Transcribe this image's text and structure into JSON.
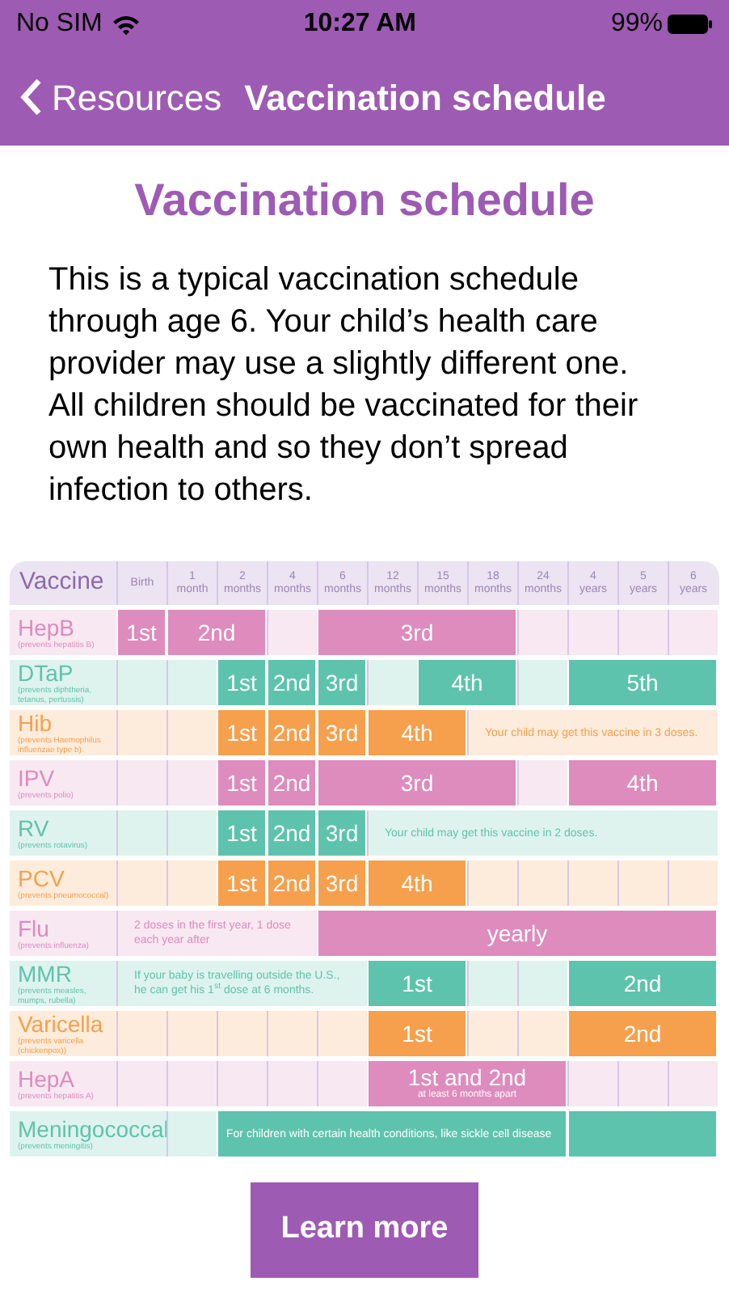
{
  "status_bar": {
    "carrier": "No SIM",
    "time": "10:27 AM",
    "battery": "99%"
  },
  "nav": {
    "back": "Resources",
    "title": "Vaccination schedule"
  },
  "heading": "Vaccination schedule",
  "intro": "This is a typical vaccination schedule through age 6. Your child’s health care provider may use a slightly different one. All children should be vaccinated for their own health and so they don’t spread infection to others.",
  "table": {
    "header": "Vaccine",
    "columns": [
      {
        "lines": [
          "Birth"
        ]
      },
      {
        "lines": [
          "1",
          "month"
        ]
      },
      {
        "lines": [
          "2",
          "months"
        ]
      },
      {
        "lines": [
          "4",
          "months"
        ]
      },
      {
        "lines": [
          "6",
          "months"
        ]
      },
      {
        "lines": [
          "12",
          "months"
        ]
      },
      {
        "lines": [
          "15",
          "months"
        ]
      },
      {
        "lines": [
          "18",
          "months"
        ]
      },
      {
        "lines": [
          "24",
          "months"
        ]
      },
      {
        "lines": [
          "4",
          "years"
        ]
      },
      {
        "lines": [
          "5",
          "years"
        ]
      },
      {
        "lines": [
          "6",
          "years"
        ]
      }
    ],
    "rows": [
      {
        "name": "HepB",
        "description": "(prevents hepatitis B)",
        "color": "#de8bbd",
        "wide_name": false,
        "cells": [
          {
            "kind": "dose",
            "label": "1st"
          },
          {
            "kind": "dose",
            "label": "2nd",
            "colspan": 2
          },
          {
            "kind": "empty"
          },
          {
            "kind": "dose",
            "label": "3rd",
            "colspan": 4
          },
          {
            "kind": "empty"
          },
          {
            "kind": "empty"
          },
          {
            "kind": "empty"
          },
          {
            "kind": "empty"
          }
        ]
      },
      {
        "name": "DTaP",
        "description": "(prevents diphtheria, tetanus, pertussis)",
        "color": "#5ec3ac",
        "wide_name": false,
        "cells": [
          {
            "kind": "empty"
          },
          {
            "kind": "empty"
          },
          {
            "kind": "dose",
            "label": "1st"
          },
          {
            "kind": "dose",
            "label": "2nd"
          },
          {
            "kind": "dose",
            "label": "3rd"
          },
          {
            "kind": "empty"
          },
          {
            "kind": "dose",
            "label": "4th",
            "colspan": 2
          },
          {
            "kind": "empty"
          },
          {
            "kind": "dose",
            "label": "5th",
            "colspan": 3
          }
        ]
      },
      {
        "name": "Hib",
        "description": "(prevents Haemophilus influenzae type b)",
        "color": "#f6a04d",
        "wide_name": false,
        "cells": [
          {
            "kind": "empty"
          },
          {
            "kind": "empty"
          },
          {
            "kind": "dose",
            "label": "1st"
          },
          {
            "kind": "dose",
            "label": "2nd"
          },
          {
            "kind": "dose",
            "label": "3rd"
          },
          {
            "kind": "dose",
            "label": "4th",
            "colspan": 2
          },
          {
            "kind": "note",
            "label": "Your child may get this vaccine in 3 doses.",
            "colspan": 5
          }
        ]
      },
      {
        "name": "IPV",
        "description": "(prevents polio)",
        "color": "#de8bbd",
        "wide_name": false,
        "cells": [
          {
            "kind": "empty"
          },
          {
            "kind": "empty"
          },
          {
            "kind": "dose",
            "label": "1st"
          },
          {
            "kind": "dose",
            "label": "2nd"
          },
          {
            "kind": "dose",
            "label": "3rd",
            "colspan": 4
          },
          {
            "kind": "empty"
          },
          {
            "kind": "dose",
            "label": "4th",
            "colspan": 3
          }
        ]
      },
      {
        "name": "RV",
        "description": "(prevents rotavirus)",
        "color": "#5ec3ac",
        "wide_name": false,
        "cells": [
          {
            "kind": "empty"
          },
          {
            "kind": "empty"
          },
          {
            "kind": "dose",
            "label": "1st"
          },
          {
            "kind": "dose",
            "label": "2nd"
          },
          {
            "kind": "dose",
            "label": "3rd"
          },
          {
            "kind": "note",
            "label": "Your child may get this vaccine in 2 doses.",
            "colspan": 7
          }
        ]
      },
      {
        "name": "PCV",
        "description": "(prevents pneumococcal)",
        "color": "#f6a04d",
        "wide_name": false,
        "cells": [
          {
            "kind": "empty"
          },
          {
            "kind": "empty"
          },
          {
            "kind": "dose",
            "label": "1st"
          },
          {
            "kind": "dose",
            "label": "2nd"
          },
          {
            "kind": "dose",
            "label": "3rd"
          },
          {
            "kind": "dose",
            "label": "4th",
            "colspan": 2
          },
          {
            "kind": "empty"
          },
          {
            "kind": "empty"
          },
          {
            "kind": "empty"
          },
          {
            "kind": "empty"
          },
          {
            "kind": "empty"
          }
        ]
      },
      {
        "name": "Flu",
        "description": "(prevents influenza)",
        "color": "#de8bbd",
        "wide_name": false,
        "cells": [
          {
            "kind": "note",
            "label": "2 doses in the first year, 1 dose each year after",
            "colspan": 4
          },
          {
            "kind": "dose",
            "label": "yearly",
            "colspan": 8
          }
        ]
      },
      {
        "name": "MMR",
        "description": "(prevents measles, mumps, rubella)",
        "color": "#5ec3ac",
        "wide_name": false,
        "cells": [
          {
            "kind": "note",
            "label": "If your baby is travelling outside the U.S., he can get his 1$^{st}$ dose at 6 months.",
            "colspan": 5
          },
          {
            "kind": "dose",
            "label": "1st",
            "colspan": 2
          },
          {
            "kind": "empty"
          },
          {
            "kind": "empty"
          },
          {
            "kind": "dose",
            "label": "2nd",
            "colspan": 3
          }
        ]
      },
      {
        "name": "Varicella",
        "description": "(prevents varicella (chickenpox))",
        "color": "#f6a04d",
        "wide_name": false,
        "cells": [
          {
            "kind": "empty"
          },
          {
            "kind": "empty"
          },
          {
            "kind": "empty"
          },
          {
            "kind": "empty"
          },
          {
            "kind": "empty"
          },
          {
            "kind": "dose",
            "label": "1st",
            "colspan": 2
          },
          {
            "kind": "empty"
          },
          {
            "kind": "empty"
          },
          {
            "kind": "dose",
            "label": "2nd",
            "colspan": 3
          }
        ]
      },
      {
        "name": "HepA",
        "description": "(prevents hepatitis A)",
        "color": "#de8bbd",
        "wide_name": false,
        "cells": [
          {
            "kind": "empty"
          },
          {
            "kind": "empty"
          },
          {
            "kind": "empty"
          },
          {
            "kind": "empty"
          },
          {
            "kind": "empty"
          },
          {
            "kind": "dose",
            "label": "1st and 2nd",
            "sublabel": "at least 6 months apart",
            "colspan": 4
          },
          {
            "kind": "empty"
          },
          {
            "kind": "empty"
          },
          {
            "kind": "empty"
          }
        ]
      },
      {
        "name": "Meningococcal",
        "description": "(prevents meningitis)",
        "color": "#5ec3ac",
        "wide_name": true,
        "cells": [
          {
            "kind": "empty"
          },
          {
            "kind": "band",
            "label": "For children with certain health conditions, like sickle cell disease",
            "colspan": 7
          },
          {
            "kind": "band",
            "colspan": 3
          }
        ]
      }
    ]
  },
  "button": "Learn more"
}
